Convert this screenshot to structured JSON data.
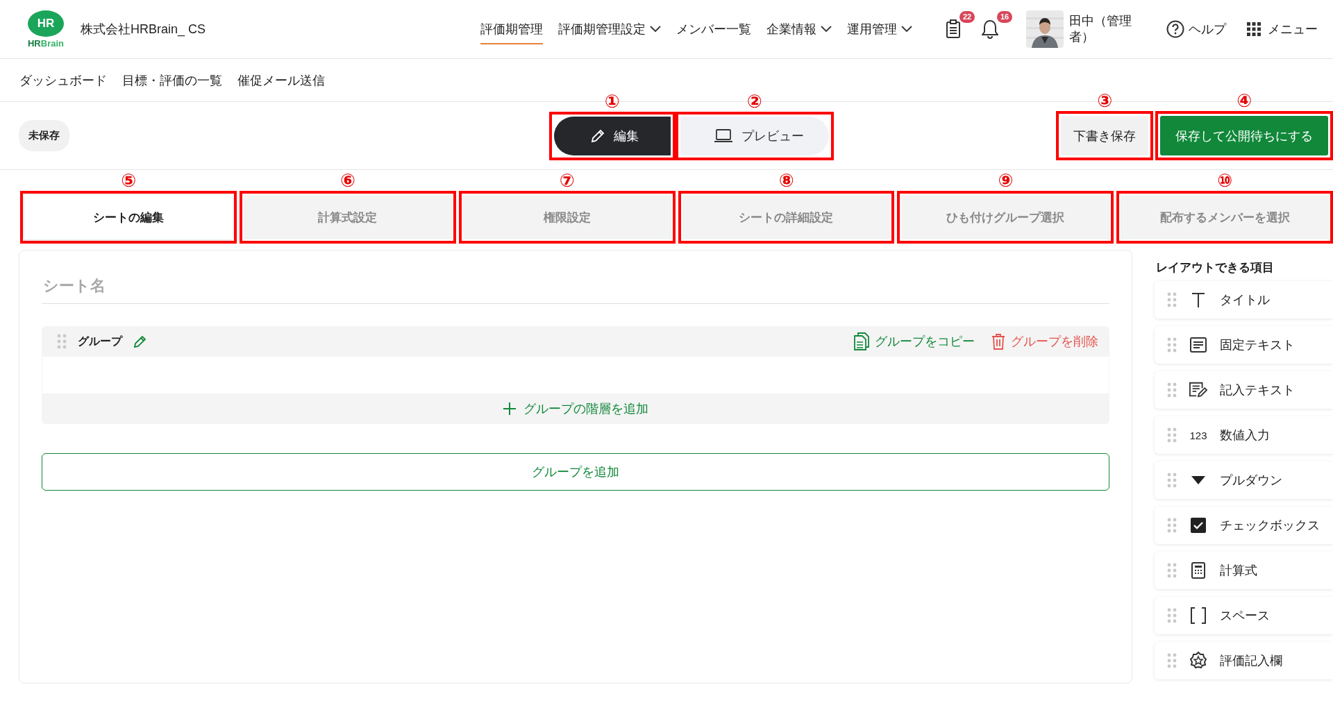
{
  "header": {
    "logo": {
      "mark": "HR",
      "wordmark_dark": "HR",
      "wordmark_light": "Brain"
    },
    "company": "株式会社HRBrain_ CS",
    "nav": [
      {
        "label": "評価期管理",
        "selected": true,
        "dropdown": false
      },
      {
        "label": "評価期管理設定",
        "selected": false,
        "dropdown": true
      },
      {
        "label": "メンバー一覧",
        "selected": false,
        "dropdown": false
      },
      {
        "label": "企業情報",
        "selected": false,
        "dropdown": true
      },
      {
        "label": "運用管理",
        "selected": false,
        "dropdown": true
      }
    ],
    "notifications": [
      {
        "kind": "clipboard",
        "count": "22"
      },
      {
        "kind": "bell",
        "count": "16"
      }
    ],
    "user": {
      "name": "田中（管理者）"
    },
    "help": "ヘルプ",
    "menu": "メニュー"
  },
  "subnav": [
    "ダッシュボード",
    "目標・評価の一覧",
    "催促メール送信"
  ],
  "toolbar": {
    "status": "未保存",
    "modes": [
      {
        "label": "編集",
        "kind": "edit",
        "selected": true,
        "marker": "①"
      },
      {
        "label": "プレビュー",
        "kind": "preview",
        "selected": false,
        "marker": "②"
      }
    ],
    "actions": [
      {
        "label": "下書き保存",
        "kind": "secondary",
        "marker": "③"
      },
      {
        "label": "保存して公開待ちにする",
        "kind": "primary",
        "marker": "④"
      }
    ]
  },
  "tabs": [
    {
      "label": "シートの編集",
      "selected": true,
      "marker": "⑤"
    },
    {
      "label": "計算式設定",
      "selected": false,
      "marker": "⑥"
    },
    {
      "label": "権限設定",
      "selected": false,
      "marker": "⑦"
    },
    {
      "label": "シートの詳細設定",
      "selected": false,
      "marker": "⑧"
    },
    {
      "label": "ひも付けグループ選択",
      "selected": false,
      "marker": "⑨"
    },
    {
      "label": "配布するメンバーを選択",
      "selected": false,
      "marker": "⑩"
    }
  ],
  "editor": {
    "sheet_name": {
      "placeholder": "シート名"
    },
    "group": {
      "title": "グループ",
      "copy": "グループをコピー",
      "delete": "グループを削除",
      "add_level": "グループの階層を追加"
    },
    "add_group": "グループを追加"
  },
  "palette": {
    "title": "レイアウトできる項目",
    "items": [
      {
        "kind": "title",
        "label": "タイトル"
      },
      {
        "kind": "fixed_text",
        "label": "固定テキスト"
      },
      {
        "kind": "input_text",
        "label": "記入テキスト"
      },
      {
        "kind": "number",
        "icon_text": "123",
        "label": "数値入力"
      },
      {
        "kind": "dropdown",
        "label": "プルダウン"
      },
      {
        "kind": "checkbox",
        "label": "チェックボックス"
      },
      {
        "kind": "formula",
        "label": "計算式"
      },
      {
        "kind": "space",
        "label": "スペース"
      },
      {
        "kind": "rating",
        "label": "評価記入欄"
      }
    ]
  }
}
